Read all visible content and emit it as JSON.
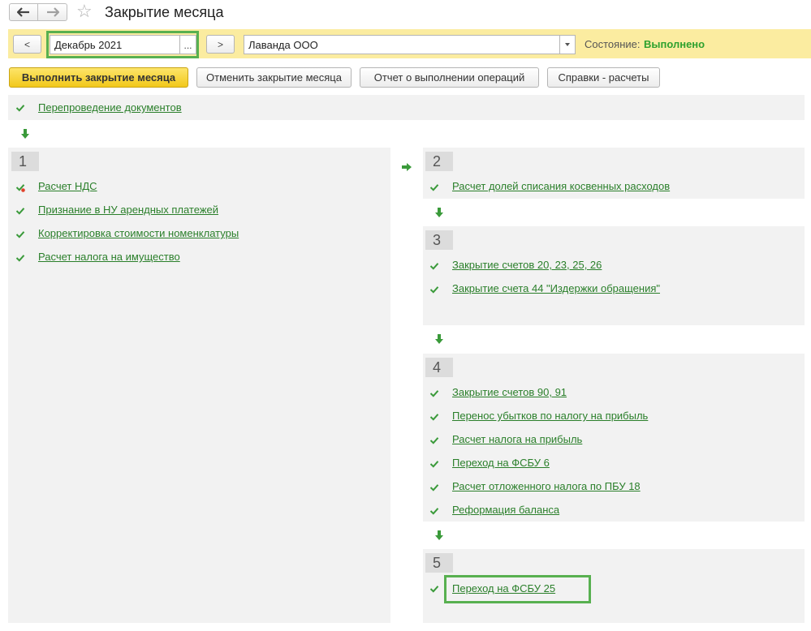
{
  "header": {
    "title": "Закрытие месяца",
    "back_icon": "arrow-left-icon",
    "forward_icon": "arrow-right-icon",
    "favorite_icon": "star-icon"
  },
  "toolbar": {
    "prev_label": "<",
    "next_label": ">",
    "period": "Декабрь 2021",
    "period_select": "...",
    "organization": "Лаванда ООО",
    "state_label": "Состояние:",
    "state_value": "Выполнено",
    "colors": {
      "band": "#fbeca0",
      "state": "#2ea12e",
      "highlight": "#58b050"
    }
  },
  "commands": {
    "run": "Выполнить закрытие месяца",
    "cancel": "Отменить закрытие месяца",
    "report": "Отчет о выполнении операций",
    "reference": "Справки - расчеты"
  },
  "reposting": {
    "label": "Перепроведение документов"
  },
  "groups": [
    {
      "number": "1",
      "operations": [
        {
          "label": "Расчет НДС",
          "status": "done-warning"
        },
        {
          "label": "Признание в НУ арендных платежей",
          "status": "done"
        },
        {
          "label": "Корректировка стоимости номенклатуры",
          "status": "done"
        },
        {
          "label": "Расчет налога на имущество",
          "status": "done"
        }
      ]
    },
    {
      "number": "2",
      "operations": [
        {
          "label": "Расчет долей списания косвенных расходов",
          "status": "done"
        }
      ]
    },
    {
      "number": "3",
      "operations": [
        {
          "label": "Закрытие счетов 20, 23, 25, 26",
          "status": "done"
        },
        {
          "label": "Закрытие счета 44 \"Издержки обращения\"",
          "status": "done"
        }
      ]
    },
    {
      "number": "4",
      "operations": [
        {
          "label": "Закрытие счетов 90, 91",
          "status": "done"
        },
        {
          "label": "Перенос убытков по налогу на прибыль",
          "status": "done"
        },
        {
          "label": "Расчет налога на прибыль",
          "status": "done"
        },
        {
          "label": "Переход на ФСБУ 6",
          "status": "done"
        },
        {
          "label": "Расчет отложенного налога по ПБУ 18",
          "status": "done"
        },
        {
          "label": "Реформация баланса",
          "status": "done"
        }
      ]
    },
    {
      "number": "5",
      "operations": [
        {
          "label": "Переход на ФСБУ 25",
          "status": "done"
        }
      ]
    }
  ]
}
